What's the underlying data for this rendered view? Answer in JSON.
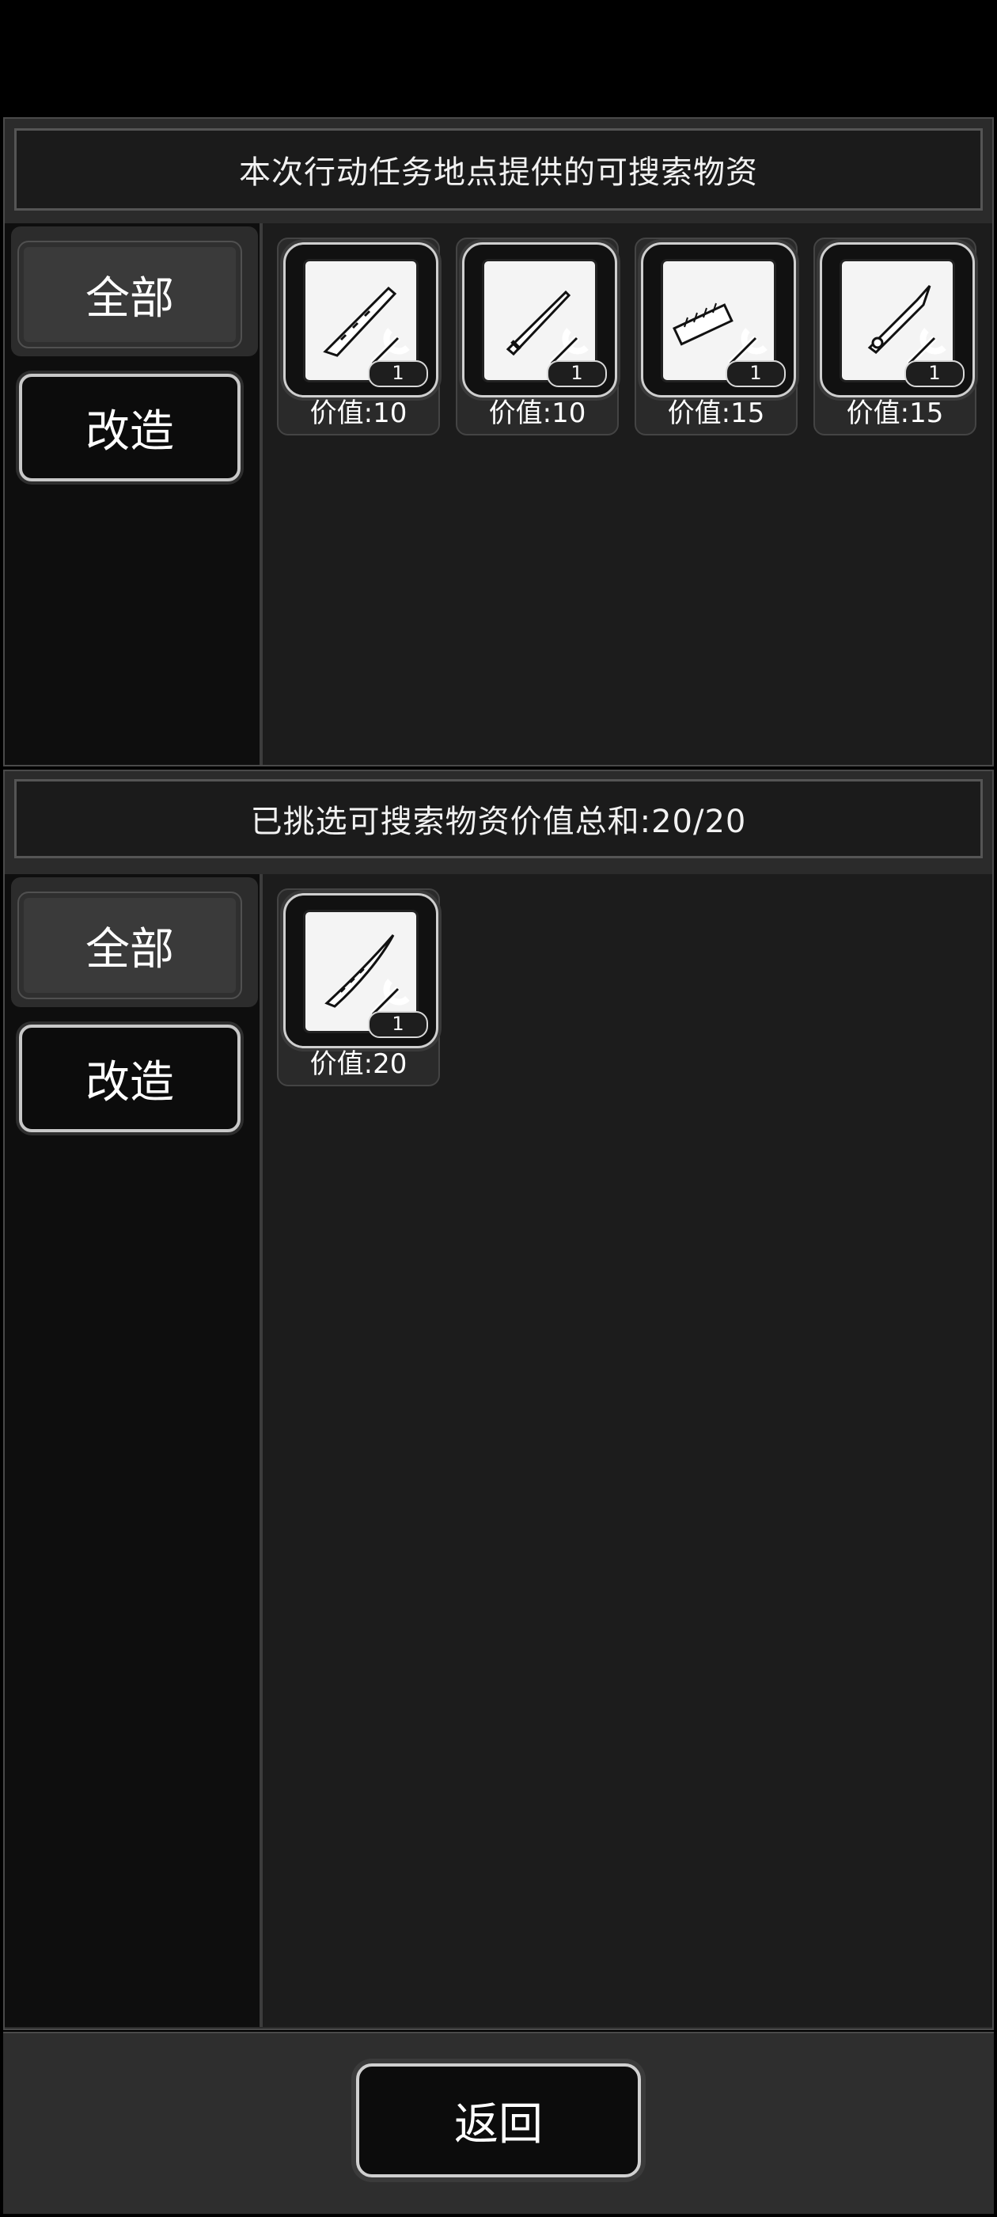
{
  "top_panel": {
    "title": "本次行动任务地点提供的可搜索物资",
    "tabs": [
      "全部",
      "改造"
    ],
    "items": [
      {
        "icon": "blade-blueprint-icon",
        "qty": "1",
        "price": "价值:10"
      },
      {
        "icon": "dagger-blueprint-icon",
        "qty": "1",
        "price": "价值:10"
      },
      {
        "icon": "rail-blueprint-icon",
        "qty": "1",
        "price": "价值:15"
      },
      {
        "icon": "spear-blueprint-icon",
        "qty": "1",
        "price": "价值:15"
      }
    ]
  },
  "bottom_panel": {
    "title": "已挑选可搜索物资价值总和:20/20",
    "tabs": [
      "全部",
      "改造"
    ],
    "items": [
      {
        "icon": "sword-blueprint-icon",
        "qty": "1",
        "price": "价值:20"
      }
    ]
  },
  "footer": {
    "back_label": "返回"
  }
}
